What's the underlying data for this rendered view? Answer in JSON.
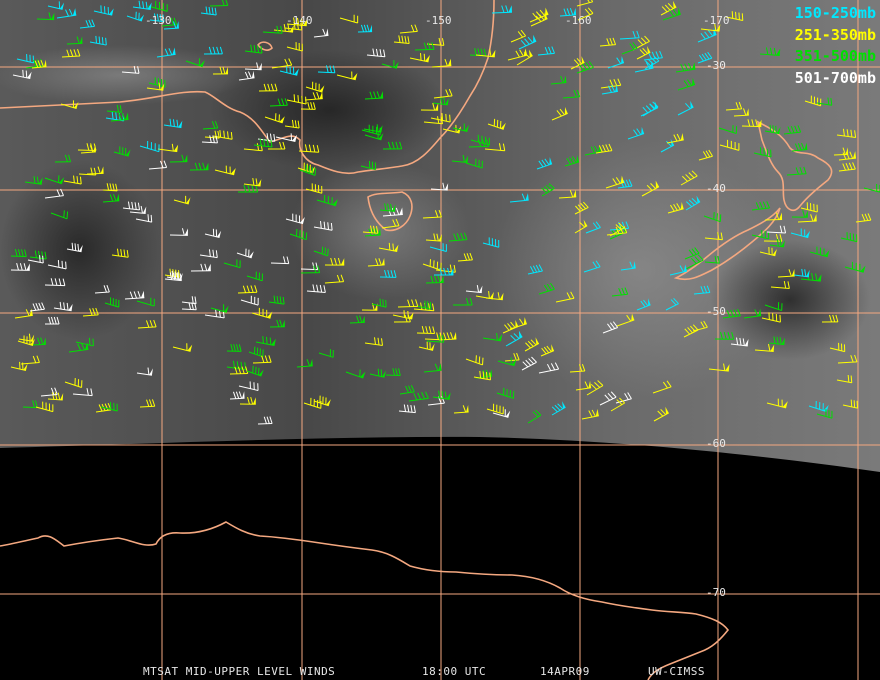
{
  "legend": [
    {
      "label": "150-250mb",
      "color": "#00e8ff"
    },
    {
      "label": "251-350mb",
      "color": "#ffff00"
    },
    {
      "label": "351-500mb",
      "color": "#00e000"
    },
    {
      "label": "501-700mb",
      "color": "#ffffff"
    }
  ],
  "longitude_labels": [
    "-130",
    "-140",
    "-150",
    "-160",
    "-170"
  ],
  "latitude_labels": [
    "-30",
    "-40",
    "-50",
    "-60",
    "-70"
  ],
  "caption": {
    "title": "MTSAT MID-UPPER LEVEL WINDS",
    "time": "18:00 UTC",
    "date": "14APR09",
    "credit": "UW-CIMSS"
  },
  "colors": {
    "grid": "#f4a880",
    "coastline": "#f4a880",
    "background": "#000000"
  }
}
